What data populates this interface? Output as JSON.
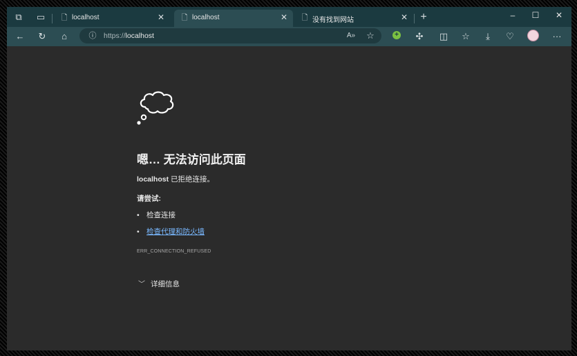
{
  "tabs": [
    {
      "title": "localhost",
      "state": "inactive",
      "icon": "page-error-icon"
    },
    {
      "title": "localhost",
      "state": "active",
      "icon": "page-error-icon"
    },
    {
      "title": "没有找到网站",
      "state": "inactive",
      "icon": "page-icon"
    }
  ],
  "window_controls": {
    "minimize": "–",
    "maximize": "☐",
    "close": "✕"
  },
  "toolbar": {
    "url_proto": "https://",
    "url_host": "localhost"
  },
  "error": {
    "title": "嗯… 无法访问此页面",
    "host": "localhost",
    "detail": " 已拒绝连接。",
    "try_label": "请尝试:",
    "suggestions": [
      {
        "text": "检查连接",
        "is_link": false
      },
      {
        "text": "检查代理和防火墙",
        "is_link": true
      }
    ],
    "code": "ERR_CONNECTION_REFUSED",
    "details_label": "详细信息"
  },
  "colors": {
    "tabbar": "#1b3a40",
    "toolbar": "#2c4d53",
    "content_bg": "#2b2b2b",
    "link": "#79b8ff"
  }
}
